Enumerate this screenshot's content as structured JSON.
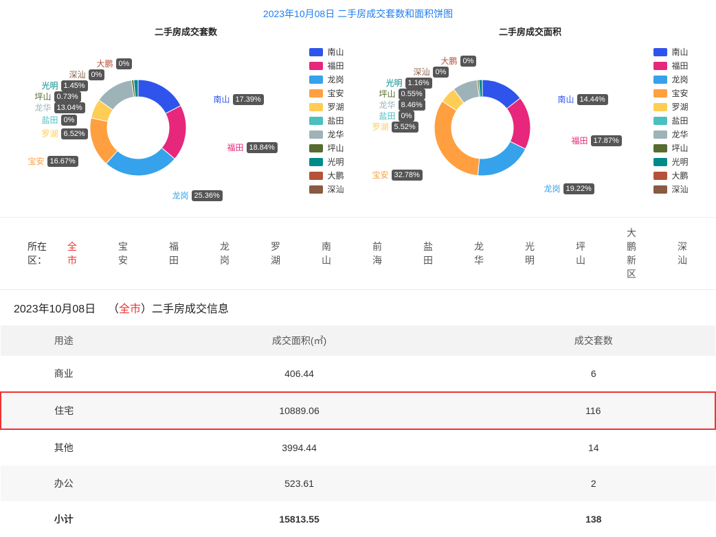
{
  "page_title": "2023年10月08日 二手房成交套数和面积饼图",
  "colors": {
    "南山": "#2f54eb",
    "福田": "#e6277b",
    "龙岗": "#36a2eb",
    "宝安": "#ff9f40",
    "罗湖": "#ffcd56",
    "盐田": "#4bc0c0",
    "龙华": "#9db3b7",
    "坪山": "#556b2f",
    "光明": "#008b8b",
    "大鹏": "#b55239",
    "深汕": "#8a5a44"
  },
  "legend_order": [
    "南山",
    "福田",
    "龙岗",
    "宝安",
    "罗湖",
    "盐田",
    "龙华",
    "坪山",
    "光明",
    "大鹏",
    "深汕"
  ],
  "chart_data": [
    {
      "type": "pie",
      "title": "二手房成交套数",
      "series": [
        {
          "name": "南山",
          "value": 17.39
        },
        {
          "name": "福田",
          "value": 18.84
        },
        {
          "name": "龙岗",
          "value": 25.36
        },
        {
          "name": "宝安",
          "value": 16.67
        },
        {
          "name": "罗湖",
          "value": 6.52
        },
        {
          "name": "盐田",
          "value": 0
        },
        {
          "name": "龙华",
          "value": 13.04
        },
        {
          "name": "坪山",
          "value": 0.73
        },
        {
          "name": "光明",
          "value": 1.45
        },
        {
          "name": "大鹏",
          "value": 0
        },
        {
          "name": "深汕",
          "value": 0
        }
      ]
    },
    {
      "type": "pie",
      "title": "二手房成交面积",
      "series": [
        {
          "name": "南山",
          "value": 14.44
        },
        {
          "name": "福田",
          "value": 17.87
        },
        {
          "name": "龙岗",
          "value": 19.22
        },
        {
          "name": "宝安",
          "value": 32.78
        },
        {
          "name": "罗湖",
          "value": 5.52
        },
        {
          "name": "盐田",
          "value": 0
        },
        {
          "name": "龙华",
          "value": 8.46
        },
        {
          "name": "坪山",
          "value": 0.55
        },
        {
          "name": "光明",
          "value": 1.16
        },
        {
          "name": "大鹏",
          "value": 0
        },
        {
          "name": "深汕",
          "value": 0
        }
      ]
    }
  ],
  "tabs": {
    "label": "所在区：",
    "items": [
      "全市",
      "宝安",
      "福田",
      "龙岗",
      "罗湖",
      "南山",
      "前海",
      "盐田",
      "龙华",
      "光明",
      "坪山",
      "大鹏新区",
      "深汕"
    ],
    "active": "全市"
  },
  "section": {
    "date": "2023年10月08日",
    "prefix": "（",
    "area": "全市",
    "suffix": "）二手房成交信息"
  },
  "table": {
    "headers": [
      "用途",
      "成交面积(㎡)",
      "成交套数"
    ],
    "rows": [
      {
        "use": "商业",
        "area": "406.44",
        "count": "6",
        "highlight": false
      },
      {
        "use": "住宅",
        "area": "10889.06",
        "count": "116",
        "highlight": true
      },
      {
        "use": "其他",
        "area": "3994.44",
        "count": "14",
        "highlight": false
      },
      {
        "use": "办公",
        "area": "523.61",
        "count": "2",
        "highlight": false
      }
    ],
    "total": {
      "use": "小计",
      "area": "15813.55",
      "count": "138"
    }
  }
}
